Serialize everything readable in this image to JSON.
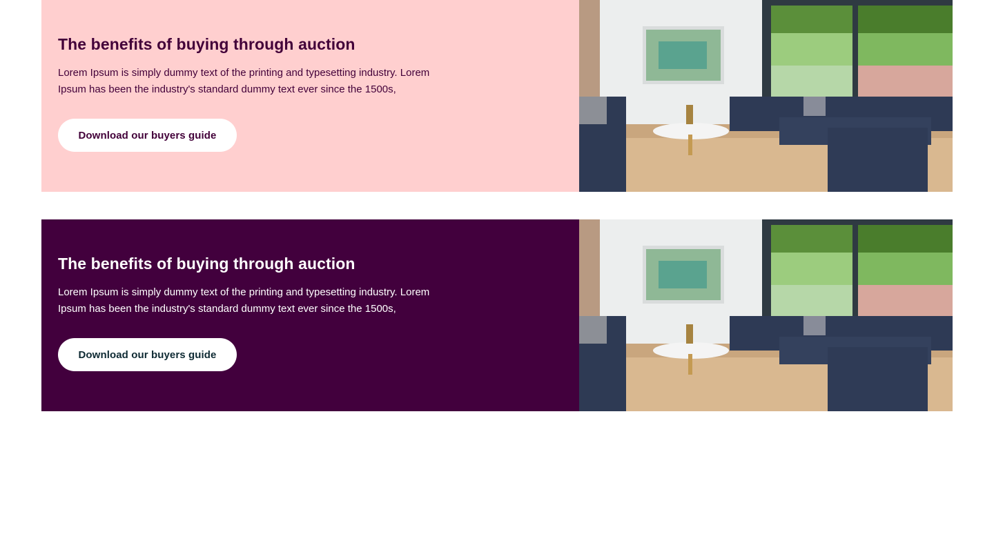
{
  "banners": [
    {
      "title": "The benefits of buying through auction",
      "body": "Lorem Ipsum is simply dummy text of the printing and typesetting industry. Lorem Ipsum has been the industry's standard dummy text ever since the 1500s,",
      "button_label": "Download our buyers guide",
      "background_color": "#ffcfcf",
      "text_color": "#420039",
      "button_text_color": "#420039"
    },
    {
      "title": "The benefits of buying through auction",
      "body": "Lorem Ipsum is simply dummy text of the printing and typesetting industry. Lorem Ipsum has been the industry's standard dummy text ever since the 1500s,",
      "button_label": "Download our buyers guide",
      "background_color": "#42003d",
      "text_color": "#ffffff",
      "button_text_color": "#0e2a33"
    }
  ]
}
